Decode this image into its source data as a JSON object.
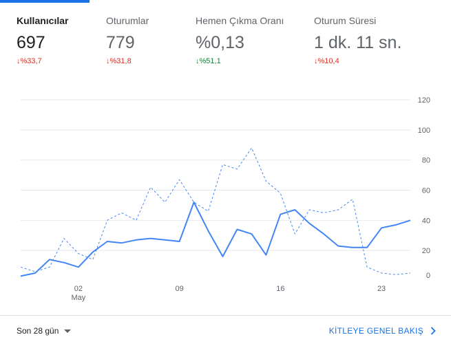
{
  "metrics": [
    {
      "label": "Kullanıcılar",
      "value": "697",
      "delta": "%33,7",
      "direction": "down",
      "active": true
    },
    {
      "label": "Oturumlar",
      "value": "779",
      "delta": "%31,8",
      "direction": "down",
      "active": false
    },
    {
      "label": "Hemen Çıkma Oranı",
      "value": "%0,13",
      "delta": "%51,1",
      "direction": "up",
      "active": false
    },
    {
      "label": "Oturum Süresi",
      "value": "1 dk. 11 sn.",
      "delta": "%10,4",
      "direction": "down",
      "active": false
    }
  ],
  "chart_data": {
    "type": "line",
    "x_tick_labels": [
      {
        "day": 5,
        "label": "02",
        "sublabel": "May"
      },
      {
        "day": 12,
        "label": "09",
        "sublabel": ""
      },
      {
        "day": 19,
        "label": "16",
        "sublabel": ""
      },
      {
        "day": 26,
        "label": "23",
        "sublabel": ""
      }
    ],
    "y_ticks": [
      0,
      20,
      40,
      60,
      80,
      100,
      120
    ],
    "ylim": [
      0,
      120
    ],
    "x_days": [
      1,
      2,
      3,
      4,
      5,
      6,
      7,
      8,
      9,
      10,
      11,
      12,
      13,
      14,
      15,
      16,
      17,
      18,
      19,
      20,
      21,
      22,
      23,
      24,
      25,
      26,
      27,
      28
    ],
    "series": [
      {
        "style": "solid",
        "color": "#4285f4",
        "values": [
          3,
          5,
          14,
          12,
          9,
          19,
          26,
          25,
          27,
          28,
          27,
          26,
          52,
          33,
          16,
          34,
          31,
          17,
          44,
          47,
          38,
          31,
          23,
          22,
          22,
          35,
          37,
          40
        ]
      },
      {
        "style": "dashed",
        "color": "#4285f4",
        "values": [
          9,
          6,
          9,
          28,
          18,
          14,
          40,
          45,
          40,
          62,
          52,
          67,
          52,
          46,
          77,
          74,
          88,
          66,
          58,
          31,
          47,
          45,
          47,
          54,
          9,
          5,
          4,
          5
        ]
      }
    ],
    "grid": true
  },
  "footer": {
    "date_range": "Son 28 gün",
    "audience_link": "KİTLEYE GENEL BAKIŞ"
  },
  "icons": {
    "arrow_down": "down-arrow-icon",
    "arrow_up": "up-arrow-icon",
    "caret": "caret-down-icon",
    "chevron": "chevron-right-icon"
  }
}
